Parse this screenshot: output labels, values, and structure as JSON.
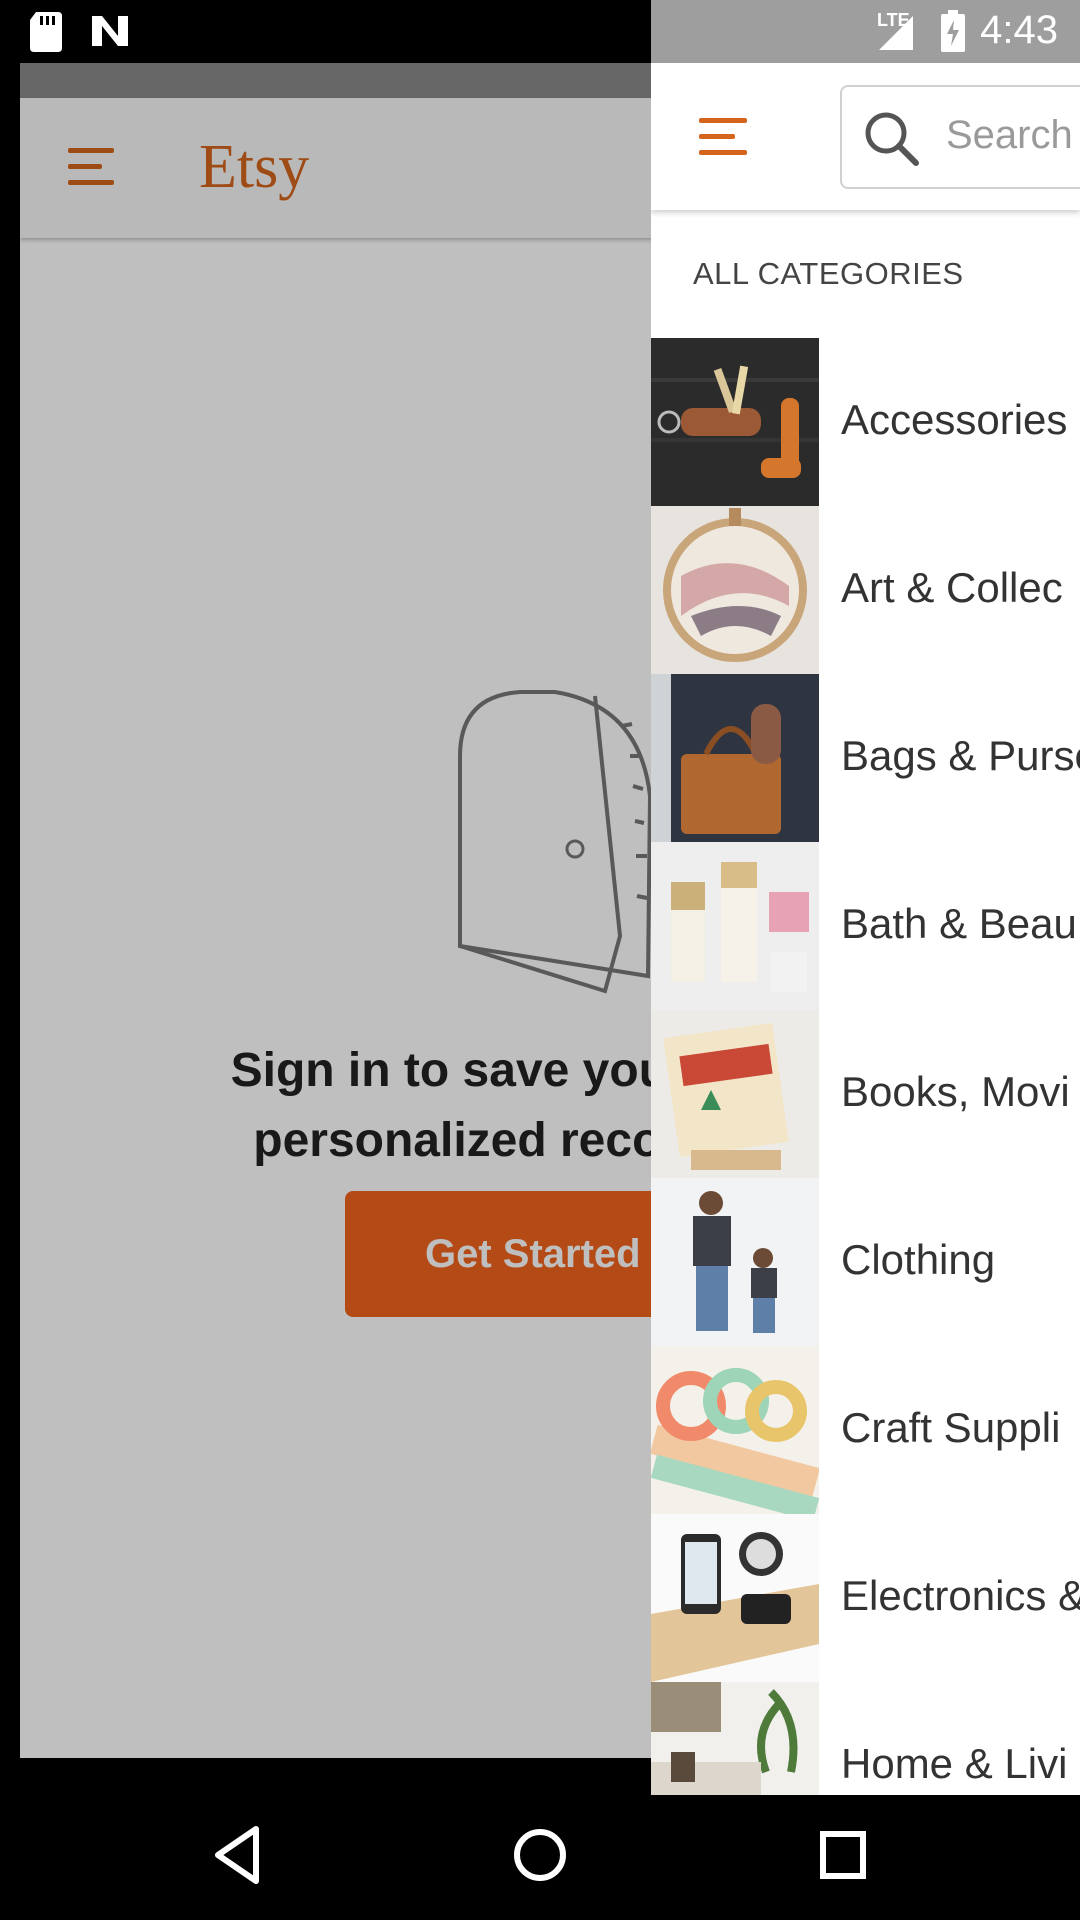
{
  "status_bar": {
    "time": "4:43",
    "network": "LTE"
  },
  "background_app": {
    "logo": "Etsy",
    "signin_text_line1": "Sign in to save your fav",
    "signin_text_line2": "personalized recomm",
    "get_started_label": "Get Started",
    "accent_color": "#d5641c"
  },
  "drawer": {
    "search_placeholder": "Search",
    "section_title": "ALL CATEGORIES",
    "categories": [
      {
        "label": "Accessories",
        "thumb_icon": "keychain-photo"
      },
      {
        "label": "Art & Collec",
        "thumb_icon": "embroidery-hoop-photo"
      },
      {
        "label": "Bags & Purse",
        "thumb_icon": "leather-tote-photo"
      },
      {
        "label": "Bath & Beau",
        "thumb_icon": "bath-products-photo"
      },
      {
        "label": "Books, Movi",
        "thumb_icon": "postcard-photo"
      },
      {
        "label": "Clothing",
        "thumb_icon": "family-shirts-photo"
      },
      {
        "label": "Craft Suppli",
        "thumb_icon": "washi-tape-photo"
      },
      {
        "label": "Electronics &",
        "thumb_icon": "phone-dock-photo"
      },
      {
        "label": "Home & Livi",
        "thumb_icon": "living-room-photo"
      }
    ]
  },
  "nav_bar": {
    "back": "back-icon",
    "home": "home-icon",
    "recents": "recents-icon"
  }
}
